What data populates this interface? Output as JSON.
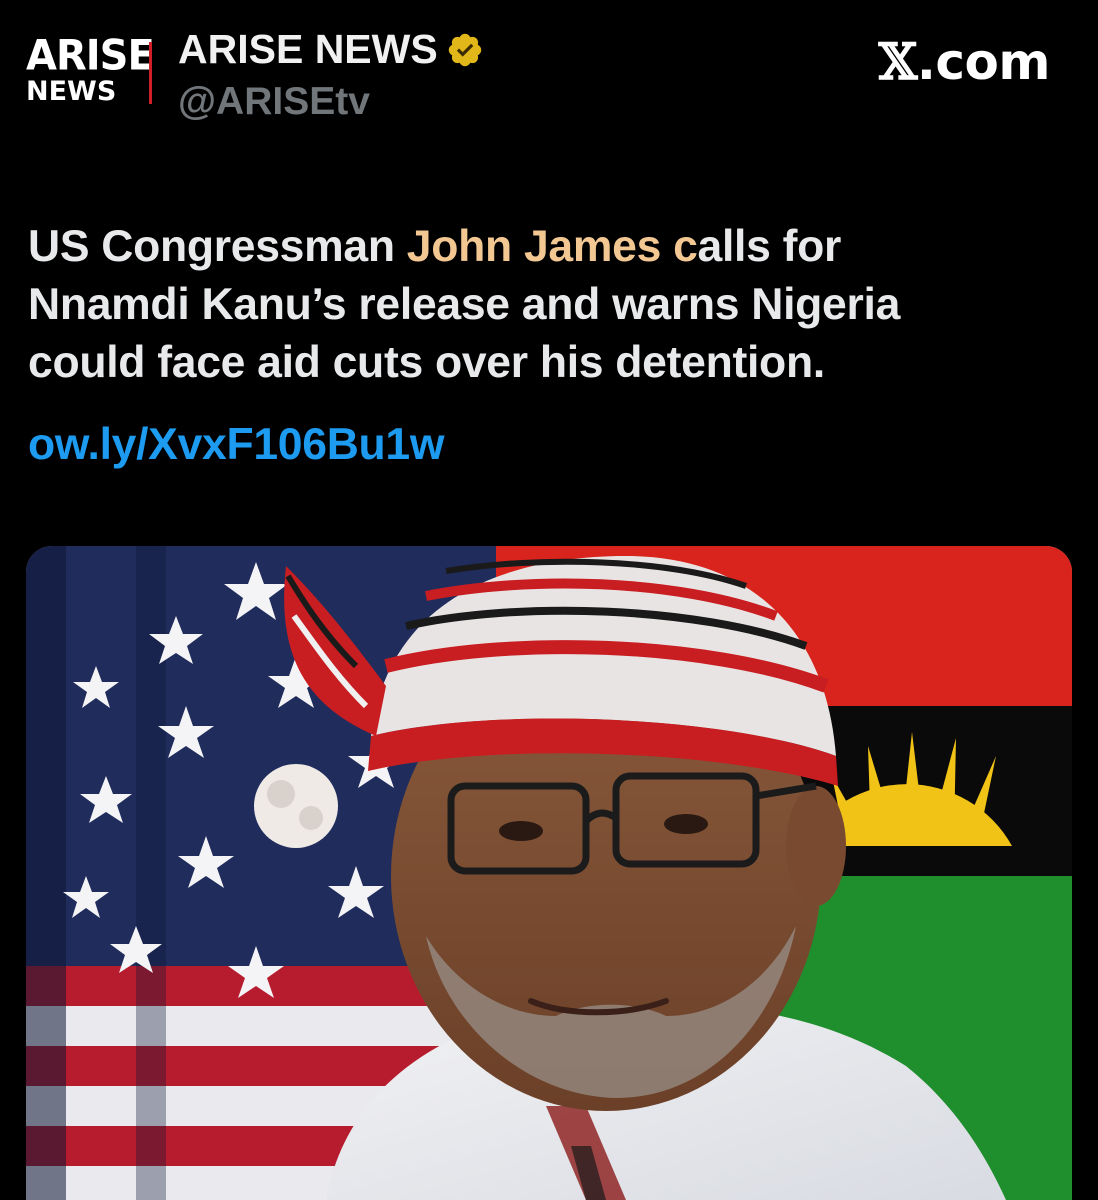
{
  "author": {
    "avatar_logo": {
      "line1": "ARISE",
      "line2": "NEWS"
    },
    "display_name": "ARISE NEWS",
    "handle": "@ARISEtv",
    "verified_icon": "gold-verified-badge-icon"
  },
  "brand": {
    "mark": "𝕏.com",
    "x_glyph": "𝕏",
    "suffix": ".com"
  },
  "post": {
    "text_lines": [
      [
        "US Congressman ",
        "John James c",
        "alls for"
      ],
      [
        "Nnamdi Kanu’s release and warns Nigeria"
      ],
      [
        "could face aid cuts over his detention."
      ]
    ],
    "text_part1": "US Congressman ",
    "text_highlight": "John James c",
    "text_part2": "alls for",
    "text_line2": "Nnamdi Kanu’s release and warns Nigeria",
    "text_line3": "could face aid cuts over his detention.",
    "link": "ow.ly/XvxF106Bu1w"
  },
  "media": {
    "kind": "photo",
    "icon": "news-photo-image"
  },
  "colors": {
    "background": "#000000",
    "text": "#e7e9ea",
    "secondary": "#71767b",
    "link": "#1d9bf0",
    "highlight": "#f2c792",
    "verified": "#e2b719",
    "logo_red": "#d11f2a"
  }
}
